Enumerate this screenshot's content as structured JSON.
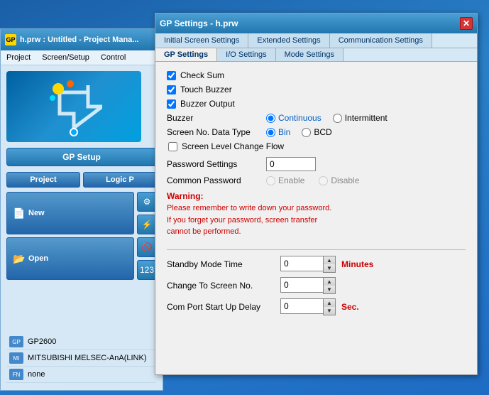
{
  "desktop": {
    "background": "#1e6bc4"
  },
  "bg_window": {
    "titlebar": "h.prw : Untitled - Project Mana...",
    "app_icon_text": "GP",
    "menu": {
      "items": [
        "Project",
        "Screen/Setup",
        "Control"
      ]
    },
    "gp_setup_label": "GP Setup",
    "tabs": {
      "project_label": "Project",
      "logic_label": "Logic P"
    },
    "new_btn_label": "New",
    "open_btn_label": "Open",
    "bottom_items": [
      {
        "icon": "GP",
        "label": "GP2600"
      },
      {
        "icon": "MI",
        "label": "MITSUBISHI MELSEC-AnA(LINK)"
      },
      {
        "icon": "FN",
        "label": "none"
      }
    ]
  },
  "dialog": {
    "title": "GP Settings - h.prw",
    "close_btn": "✕",
    "tabs_row1": [
      {
        "label": "Initial Screen Settings",
        "active": false
      },
      {
        "label": "Extended Settings",
        "active": false
      },
      {
        "label": "Communication Settings",
        "active": false
      }
    ],
    "tabs_row2": [
      {
        "label": "GP Settings",
        "active": true
      },
      {
        "label": "I/O Settings",
        "active": false
      },
      {
        "label": "Mode Settings",
        "active": false
      }
    ],
    "checkboxes": [
      {
        "label": "Check Sum",
        "checked": true
      },
      {
        "label": "Touch Buzzer",
        "checked": true
      },
      {
        "label": "Buzzer Output",
        "checked": true
      }
    ],
    "buzzer": {
      "label": "Buzzer",
      "options": [
        {
          "label": "Continuous",
          "selected": true
        },
        {
          "label": "Intermittent",
          "selected": false
        }
      ]
    },
    "screen_data_type": {
      "label": "Screen No. Data Type",
      "options": [
        {
          "label": "Bin",
          "selected": true
        },
        {
          "label": "BCD",
          "selected": false
        }
      ]
    },
    "screen_level": {
      "label": "Screen Level Change Flow",
      "checked": false
    },
    "password_settings": {
      "label": "Password Settings",
      "value": "0"
    },
    "common_password": {
      "label": "Common Password",
      "options": [
        {
          "label": "Enable",
          "enabled": false
        },
        {
          "label": "Disable",
          "enabled": false
        }
      ]
    },
    "warning": {
      "title": "Warning:",
      "lines": [
        "Please remember to write down your password.",
        "If you forget your password, screen transfer",
        "cannot be performed."
      ]
    },
    "standby_mode": {
      "label": "Standby Mode Time",
      "value": "0",
      "unit": "Minutes"
    },
    "change_screen": {
      "label": "Change To Screen No.",
      "value": "0",
      "unit": ""
    },
    "com_port_delay": {
      "label": "Com Port Start Up Delay",
      "value": "0",
      "unit": "Sec."
    }
  }
}
